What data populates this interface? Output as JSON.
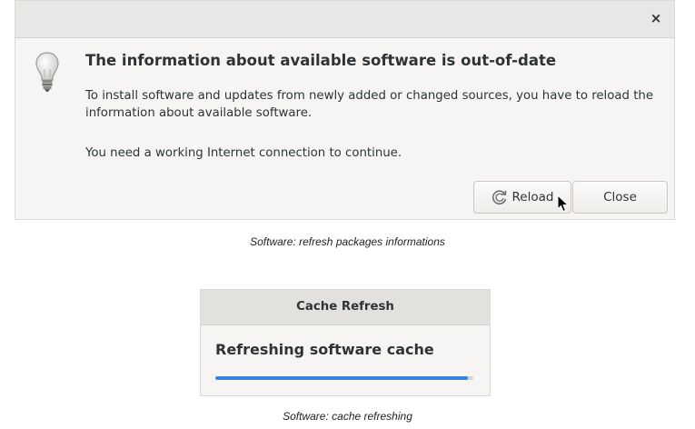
{
  "refresh_dialog": {
    "close_glyph": "×",
    "heading": "The information about available software is out-of-date",
    "body": "To install software and updates from newly added or changed sources, you have to reload the information about available software.",
    "body2": "You need a working Internet connection to continue.",
    "reload_label": "Reload",
    "close_label": "Close",
    "icon": "lightbulb-icon"
  },
  "caption1": "Software: refresh packages informations",
  "cache_dialog": {
    "title": "Cache Refresh",
    "status": "Refreshing software cache",
    "progress": 0.98,
    "accent": "#3584e4"
  },
  "caption2": "Software: cache refreshing"
}
